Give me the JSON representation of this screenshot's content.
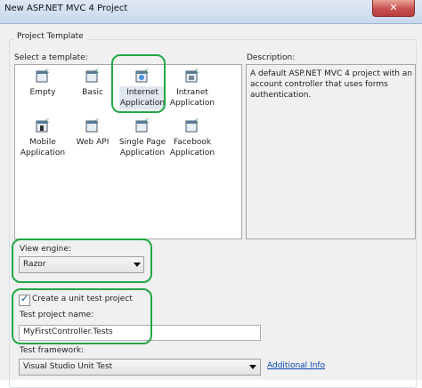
{
  "window": {
    "title": "New ASP.NET MVC 4 Project",
    "close_symbol": "✕"
  },
  "group": {
    "title": "Project Template"
  },
  "templates": {
    "label": "Select a template:",
    "items": [
      {
        "label": "Empty",
        "icon": "empty-project-icon"
      },
      {
        "label": "Basic",
        "icon": "basic-project-icon"
      },
      {
        "label": "Internet Application",
        "icon": "internet-app-icon"
      },
      {
        "label": "Intranet Application",
        "icon": "intranet-app-icon"
      },
      {
        "label": "Mobile Application",
        "icon": "mobile-app-icon"
      },
      {
        "label": "Web API",
        "icon": "web-api-icon"
      },
      {
        "label": "Single Page Application",
        "icon": "spa-icon"
      },
      {
        "label": "Facebook Application",
        "icon": "facebook-app-icon"
      }
    ],
    "selected_index": 2
  },
  "description": {
    "label": "Description:",
    "text": "A default ASP.NET MVC 4 project with an account controller that uses forms authentication."
  },
  "view_engine": {
    "label": "View engine:",
    "value": "Razor"
  },
  "unit_test": {
    "checkbox_label": "Create a unit test project",
    "checked": true,
    "project_name_label": "Test project name:",
    "project_name_value": "MyFirstController.Tests",
    "framework_label": "Test framework:",
    "framework_value": "Visual Studio Unit Test",
    "additional_info_link": "Additional Info"
  },
  "colors": {
    "highlight": "#22a745",
    "accent": "#1e4f7a"
  }
}
